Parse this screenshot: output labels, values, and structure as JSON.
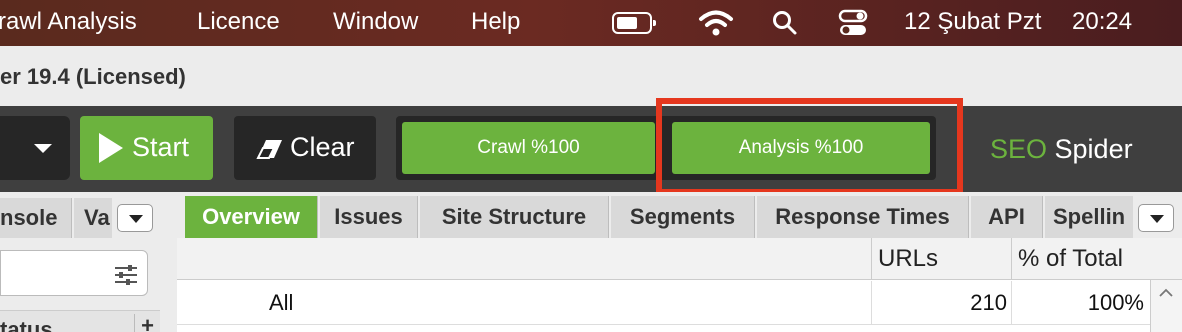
{
  "menubar": {
    "items": [
      "rawl Analysis",
      "Licence",
      "Window",
      "Help"
    ],
    "date": "12 Şubat Pzt",
    "time": "20:24",
    "icons": [
      "battery-icon",
      "wifi-icon",
      "search-icon",
      "control-center-icon"
    ]
  },
  "window": {
    "title": "er 19.4 (Licensed)"
  },
  "toolbar": {
    "start_label": "Start",
    "clear_label": "Clear",
    "crawl_progress": {
      "label": "Crawl %100",
      "value": 100
    },
    "analysis_progress": {
      "label": "Analysis %100",
      "value": 100
    },
    "brand_seo": "SEO",
    "brand_rest": " Spider",
    "colors": {
      "accent": "#6cb33e",
      "highlight": "#e5371e",
      "toolbar": "#3f3f3f"
    }
  },
  "left_panel": {
    "tabs": [
      "nsole",
      "Va"
    ],
    "status_label": "tatus",
    "plus_label": "+"
  },
  "right_panel": {
    "tabs": [
      "Overview",
      "Issues",
      "Site Structure",
      "Segments",
      "Response Times",
      "API",
      "Spellin"
    ],
    "active_tab": "Overview"
  },
  "table": {
    "columns": [
      "",
      "URLs",
      "% of Total"
    ],
    "rows": [
      {
        "label": "All",
        "urls": "210",
        "percent": "100%"
      }
    ]
  }
}
